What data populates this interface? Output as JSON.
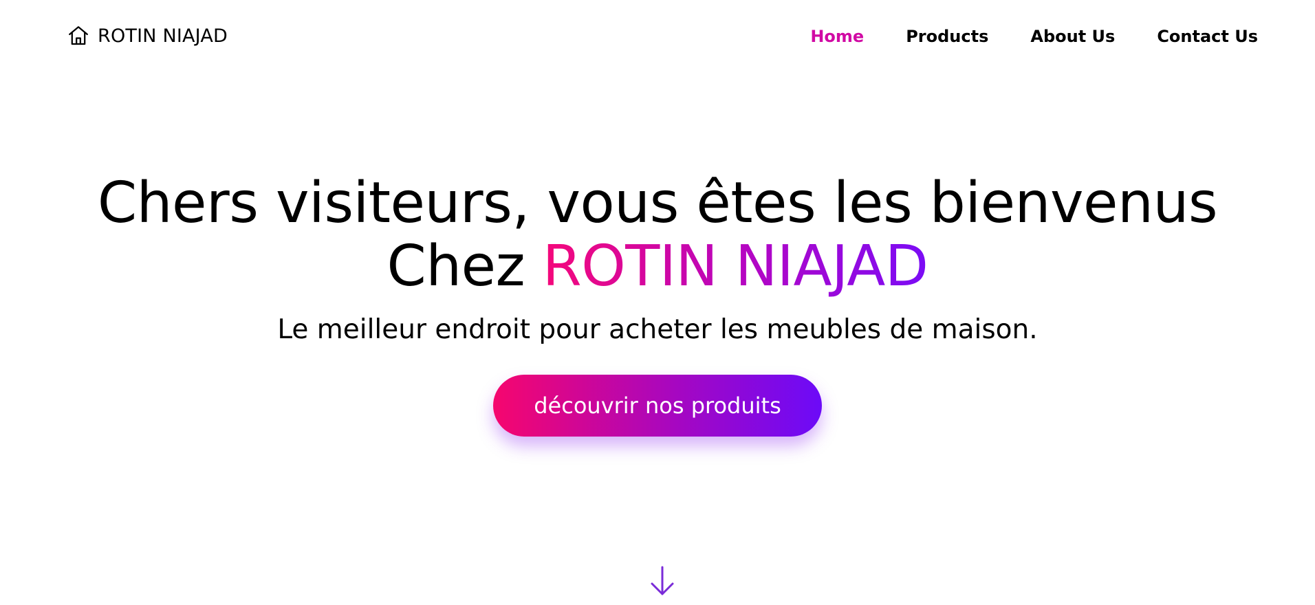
{
  "brand": {
    "name": "ROTIN NIAJAD",
    "icon": "home-icon"
  },
  "nav": {
    "items": [
      {
        "label": "Home",
        "active": true
      },
      {
        "label": "Products",
        "active": false
      },
      {
        "label": "About Us",
        "active": false
      },
      {
        "label": "Contact Us",
        "active": false
      }
    ]
  },
  "hero": {
    "title_line1": "Chers visiteurs, vous êtes les bienvenus",
    "title_line2_prefix": "Chez",
    "title_line2_highlight": "ROTIN NIAJAD",
    "subtitle": "Le meilleur endroit pour acheter les meubles de maison.",
    "cta_label": "découvrir nos produits"
  },
  "scroll_indicator": {
    "icon": "arrow-down-icon"
  },
  "colors": {
    "accent_start": "#f5087a",
    "accent_end": "#7a0cf6",
    "active_nav": "#d10aa4",
    "text": "#000000",
    "background": "#ffffff"
  }
}
